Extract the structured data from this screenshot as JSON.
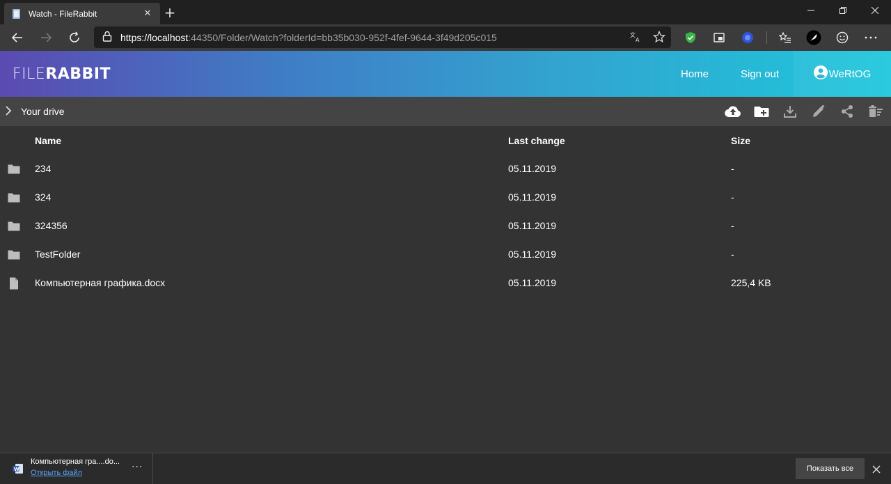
{
  "browser": {
    "tab_title": "Watch - FileRabbit",
    "url_host": "https://localhost",
    "url_rest": ":44350/Folder/Watch?folderId=bb35b030-952f-4fef-9644-3f49d205c015"
  },
  "header": {
    "logo_light": "FILE",
    "logo_bold": "RABBIT",
    "nav": {
      "home": "Home",
      "sign_out": "Sign out"
    },
    "user_name": "WeRtOG"
  },
  "breadcrumb": {
    "label": "Your drive"
  },
  "table": {
    "columns": {
      "name": "Name",
      "last_change": "Last change",
      "size": "Size"
    },
    "rows": [
      {
        "type": "folder",
        "name": "234",
        "last_change": "05.11.2019",
        "size": "-"
      },
      {
        "type": "folder",
        "name": "324",
        "last_change": "05.11.2019",
        "size": "-"
      },
      {
        "type": "folder",
        "name": "324356",
        "last_change": "05.11.2019",
        "size": "-"
      },
      {
        "type": "folder",
        "name": "TestFolder",
        "last_change": "05.11.2019",
        "size": "-"
      },
      {
        "type": "file",
        "name": "Компьютерная графика.docx",
        "last_change": "05.11.2019",
        "size": "225,4 KB"
      }
    ]
  },
  "download_bar": {
    "file_name": "Компьютерная гра....do...",
    "open_label": "Открыть файл",
    "more_label": "···",
    "show_all_label": "Показать все"
  },
  "colors": {
    "header_gradient_start": "#5b4ab1",
    "header_gradient_end": "#1ec7dc",
    "background": "#333333",
    "actionbar": "#444444",
    "link": "#5aa4ff"
  }
}
